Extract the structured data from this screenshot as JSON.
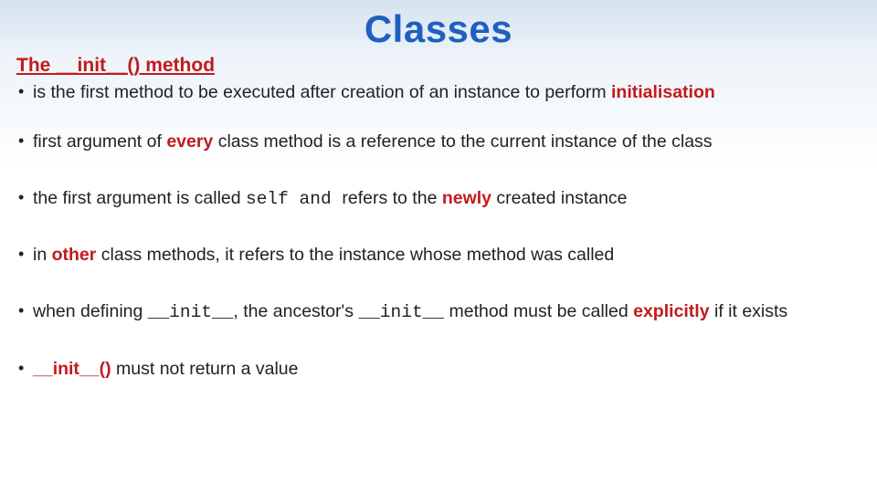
{
  "title": "Classes",
  "subtitle": "The __init__() method",
  "bullets": {
    "b1": {
      "pre": "is the first method to be executed after creation of an instance to perform ",
      "em": "initialisation"
    },
    "b2": {
      "pre": "first argument of ",
      "em": "every",
      "post": " class method is a reference to the current instance of the class"
    },
    "b3": {
      "pre": "the first argument is called ",
      "code": "self",
      "mid": " and ",
      "post1": "refers to the ",
      "em": "newly",
      "post2": " created instance"
    },
    "b4": {
      "pre": " in ",
      "em": "other",
      "post": " class methods, it refers to the instance whose method was called"
    },
    "b5": {
      "pre": " when defining ",
      "code1": "__init__",
      "mid1": ", the ancestor's ",
      "code2": "__init__",
      "mid2": "  method must be called ",
      "em": "explicitly",
      "post": " if it exists"
    },
    "b6": {
      "em": "__init__()",
      "post": " must not return a value"
    }
  }
}
